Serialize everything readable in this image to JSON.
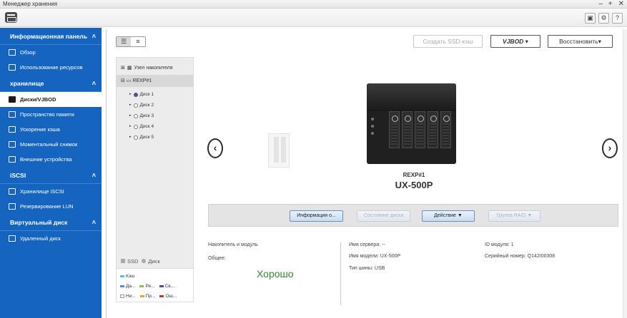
{
  "window": {
    "title": "Менеджер хранения",
    "controls": [
      "‒",
      "+",
      "✕"
    ]
  },
  "toolbar": {
    "icons": [
      "storage-icon",
      "settings-icon",
      "help-icon"
    ],
    "help_glyph": "?"
  },
  "sidebar": {
    "sections": [
      {
        "title": "Информационная панель",
        "items": [
          {
            "label": "Обзор",
            "icon": "overview-icon"
          },
          {
            "label": "Использование ресурсов",
            "icon": "chart-icon"
          }
        ]
      },
      {
        "title": "хранилище",
        "items": [
          {
            "label": "Диски/VJBOD",
            "icon": "disks-icon",
            "active": true
          },
          {
            "label": "Пространство памяти",
            "icon": "storage-space-icon"
          },
          {
            "label": "Ускорение кэша",
            "icon": "cache-icon"
          },
          {
            "label": "Моментальный снимок",
            "icon": "snapshot-icon"
          },
          {
            "label": "Внешние устройства",
            "icon": "external-device-icon"
          }
        ]
      },
      {
        "title": "iSCSI",
        "items": [
          {
            "label": "Хранилище iSCSI",
            "icon": "iscsi-icon"
          },
          {
            "label": "Резервирование LUN",
            "icon": "lun-backup-icon"
          }
        ]
      },
      {
        "title": "Виртуальный диск",
        "items": [
          {
            "label": "Удаленный диск",
            "icon": "remote-disk-icon"
          }
        ]
      }
    ]
  },
  "main": {
    "buttons": {
      "ssd_cache": "Создать SSD-кэш",
      "vjbod": "VJBOD ▾",
      "restore": "Восстановить▾"
    },
    "tree": {
      "root": "Узел накопителя",
      "node": "REXP#1",
      "disks": [
        "Диск 1",
        "Диск 2",
        "Диск 3",
        "Диск 4",
        "Диск 5"
      ]
    },
    "legend": {
      "types": [
        "SSD",
        "Диск"
      ],
      "rows": [
        [
          {
            "label": "Кэш",
            "color": "#5bc0de"
          }
        ],
        [
          {
            "label": "Да...",
            "color": "#4a90d9"
          },
          {
            "label": "Ре...",
            "color": "#8bc34a"
          },
          {
            "label": "Св...",
            "color": "#5b4a8a"
          }
        ],
        [
          {
            "label": "Ни...",
            "color": "#ffffff"
          },
          {
            "label": "Пр...",
            "color": "#f0a030"
          },
          {
            "label": "Ош...",
            "color": "#c0392b"
          }
        ]
      ]
    },
    "device": {
      "sub": "REXP#1",
      "model": "UX-500P"
    },
    "actions": {
      "info": "Информация о...",
      "disk_status": "Состояние диска",
      "action": "Действие ▼",
      "raid_group": "Группа RAID ▼"
    },
    "info": {
      "section": "Накопитель и модуль",
      "general": "Общее:",
      "status": "Хорошо",
      "server_name": "Имя сервера: --",
      "model_name": "Имя модели: UX-500P",
      "bus_type": "Тип шины: USB",
      "module_id": "ID модуля: 1",
      "serial": "Серийный номер: Q142I00308"
    }
  }
}
